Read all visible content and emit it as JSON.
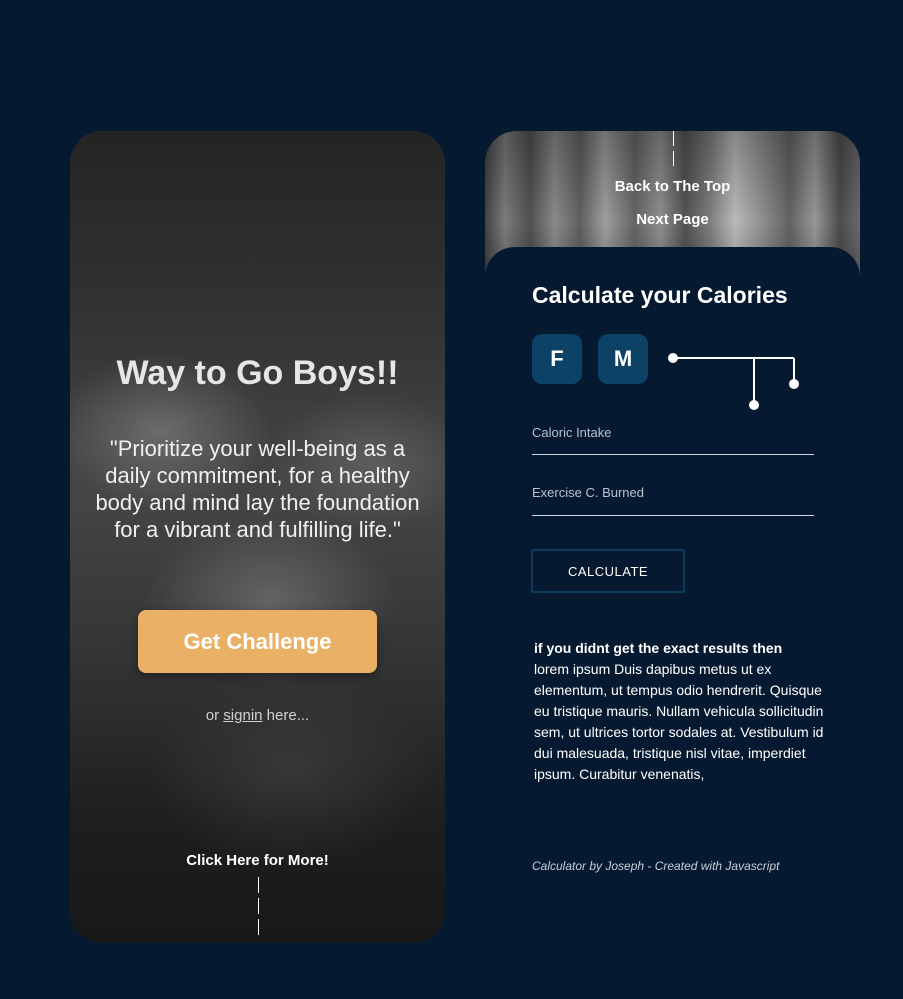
{
  "left_card": {
    "title": "Way to Go Boys!!",
    "quote": "\"Prioritize your well-being as a daily commitment, for a healthy body and mind lay the foundation for a vibrant and fulfilling life.\"",
    "challenge_button": "Get Challenge",
    "signin_prefix": "or ",
    "signin_link": "signin",
    "signin_suffix": " here...",
    "more_link": "Click Here for More!"
  },
  "right_card": {
    "back_to_top": "Back to The Top",
    "next_page": "Next Page",
    "calc_title": "Calculate your Calories",
    "gender_female": "F",
    "gender_male": "M",
    "caloric_intake_label": "Caloric Intake",
    "exercise_label": "Exercise C. Burned",
    "calculate_button": "CALCULATE",
    "info_heading": "if you didnt get the exact results then",
    "info_body": "lorem ipsum Duis dapibus metus ut ex elementum, ut tempus odio hendrerit. Quisque eu tristique mauris. Nullam vehicula sollicitudin sem, ut ultrices tortor sodales at. Vestibulum id dui malesuada, tristique nisl vitae, imperdiet ipsum. Curabitur venenatis,",
    "footer": "Calculator by Joseph - Created with Javascript"
  },
  "colors": {
    "background": "#051a31",
    "accent": "#e9b066",
    "gender_button": "#0b4266"
  }
}
